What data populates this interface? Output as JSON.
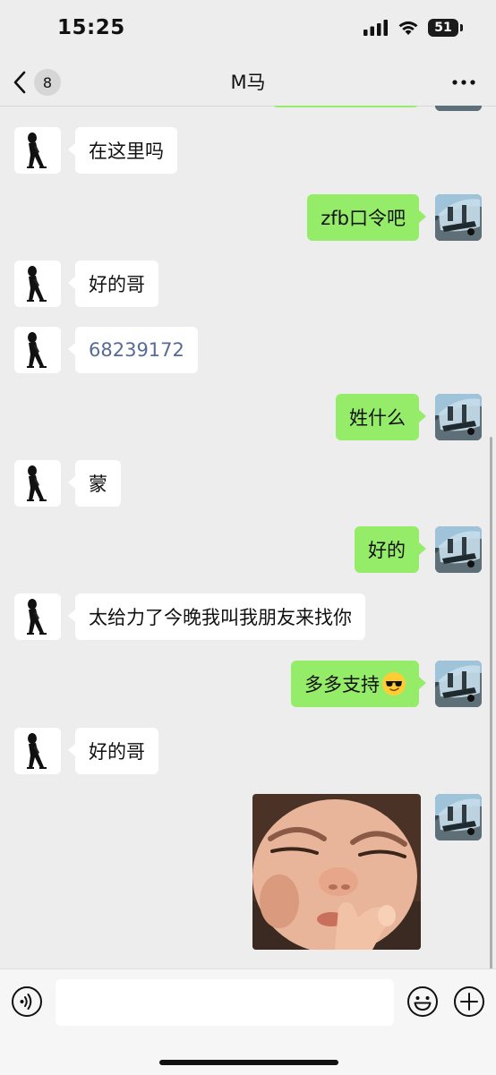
{
  "status_bar": {
    "time": "15:25",
    "battery": "51",
    "icons": [
      "signal-icon",
      "wifi-icon",
      "battery-icon"
    ]
  },
  "nav": {
    "back_icon": "chevron-left-icon",
    "unread_count": "8",
    "title": "M马",
    "more_icon": "more-dots-icon"
  },
  "messages": [
    {
      "side": "left",
      "text": "在这里吗"
    },
    {
      "side": "right",
      "text": "zfb口令吧"
    },
    {
      "side": "left",
      "text": "好的哥"
    },
    {
      "side": "left",
      "text": "68239172",
      "style": "link"
    },
    {
      "side": "right",
      "text": "姓什么"
    },
    {
      "side": "left",
      "text": "蒙"
    },
    {
      "side": "right",
      "text": "好的"
    },
    {
      "side": "left",
      "text": "太给力了今晚我叫我朋友来找你"
    },
    {
      "side": "right",
      "text": "多多支持",
      "emoji": "sunglasses-emoji"
    },
    {
      "side": "left",
      "text": "好的哥"
    },
    {
      "side": "right",
      "type": "sticker",
      "sticker": "child-face-sticker"
    }
  ],
  "input_bar": {
    "voice_icon": "voice-icon",
    "placeholder": "",
    "value": "",
    "emoji_icon": "emoji-icon",
    "plus_icon": "plus-icon"
  },
  "colors": {
    "background": "#ededed",
    "sent_bubble": "#95ec69",
    "received_bubble": "#ffffff",
    "link_text": "#576b95"
  }
}
